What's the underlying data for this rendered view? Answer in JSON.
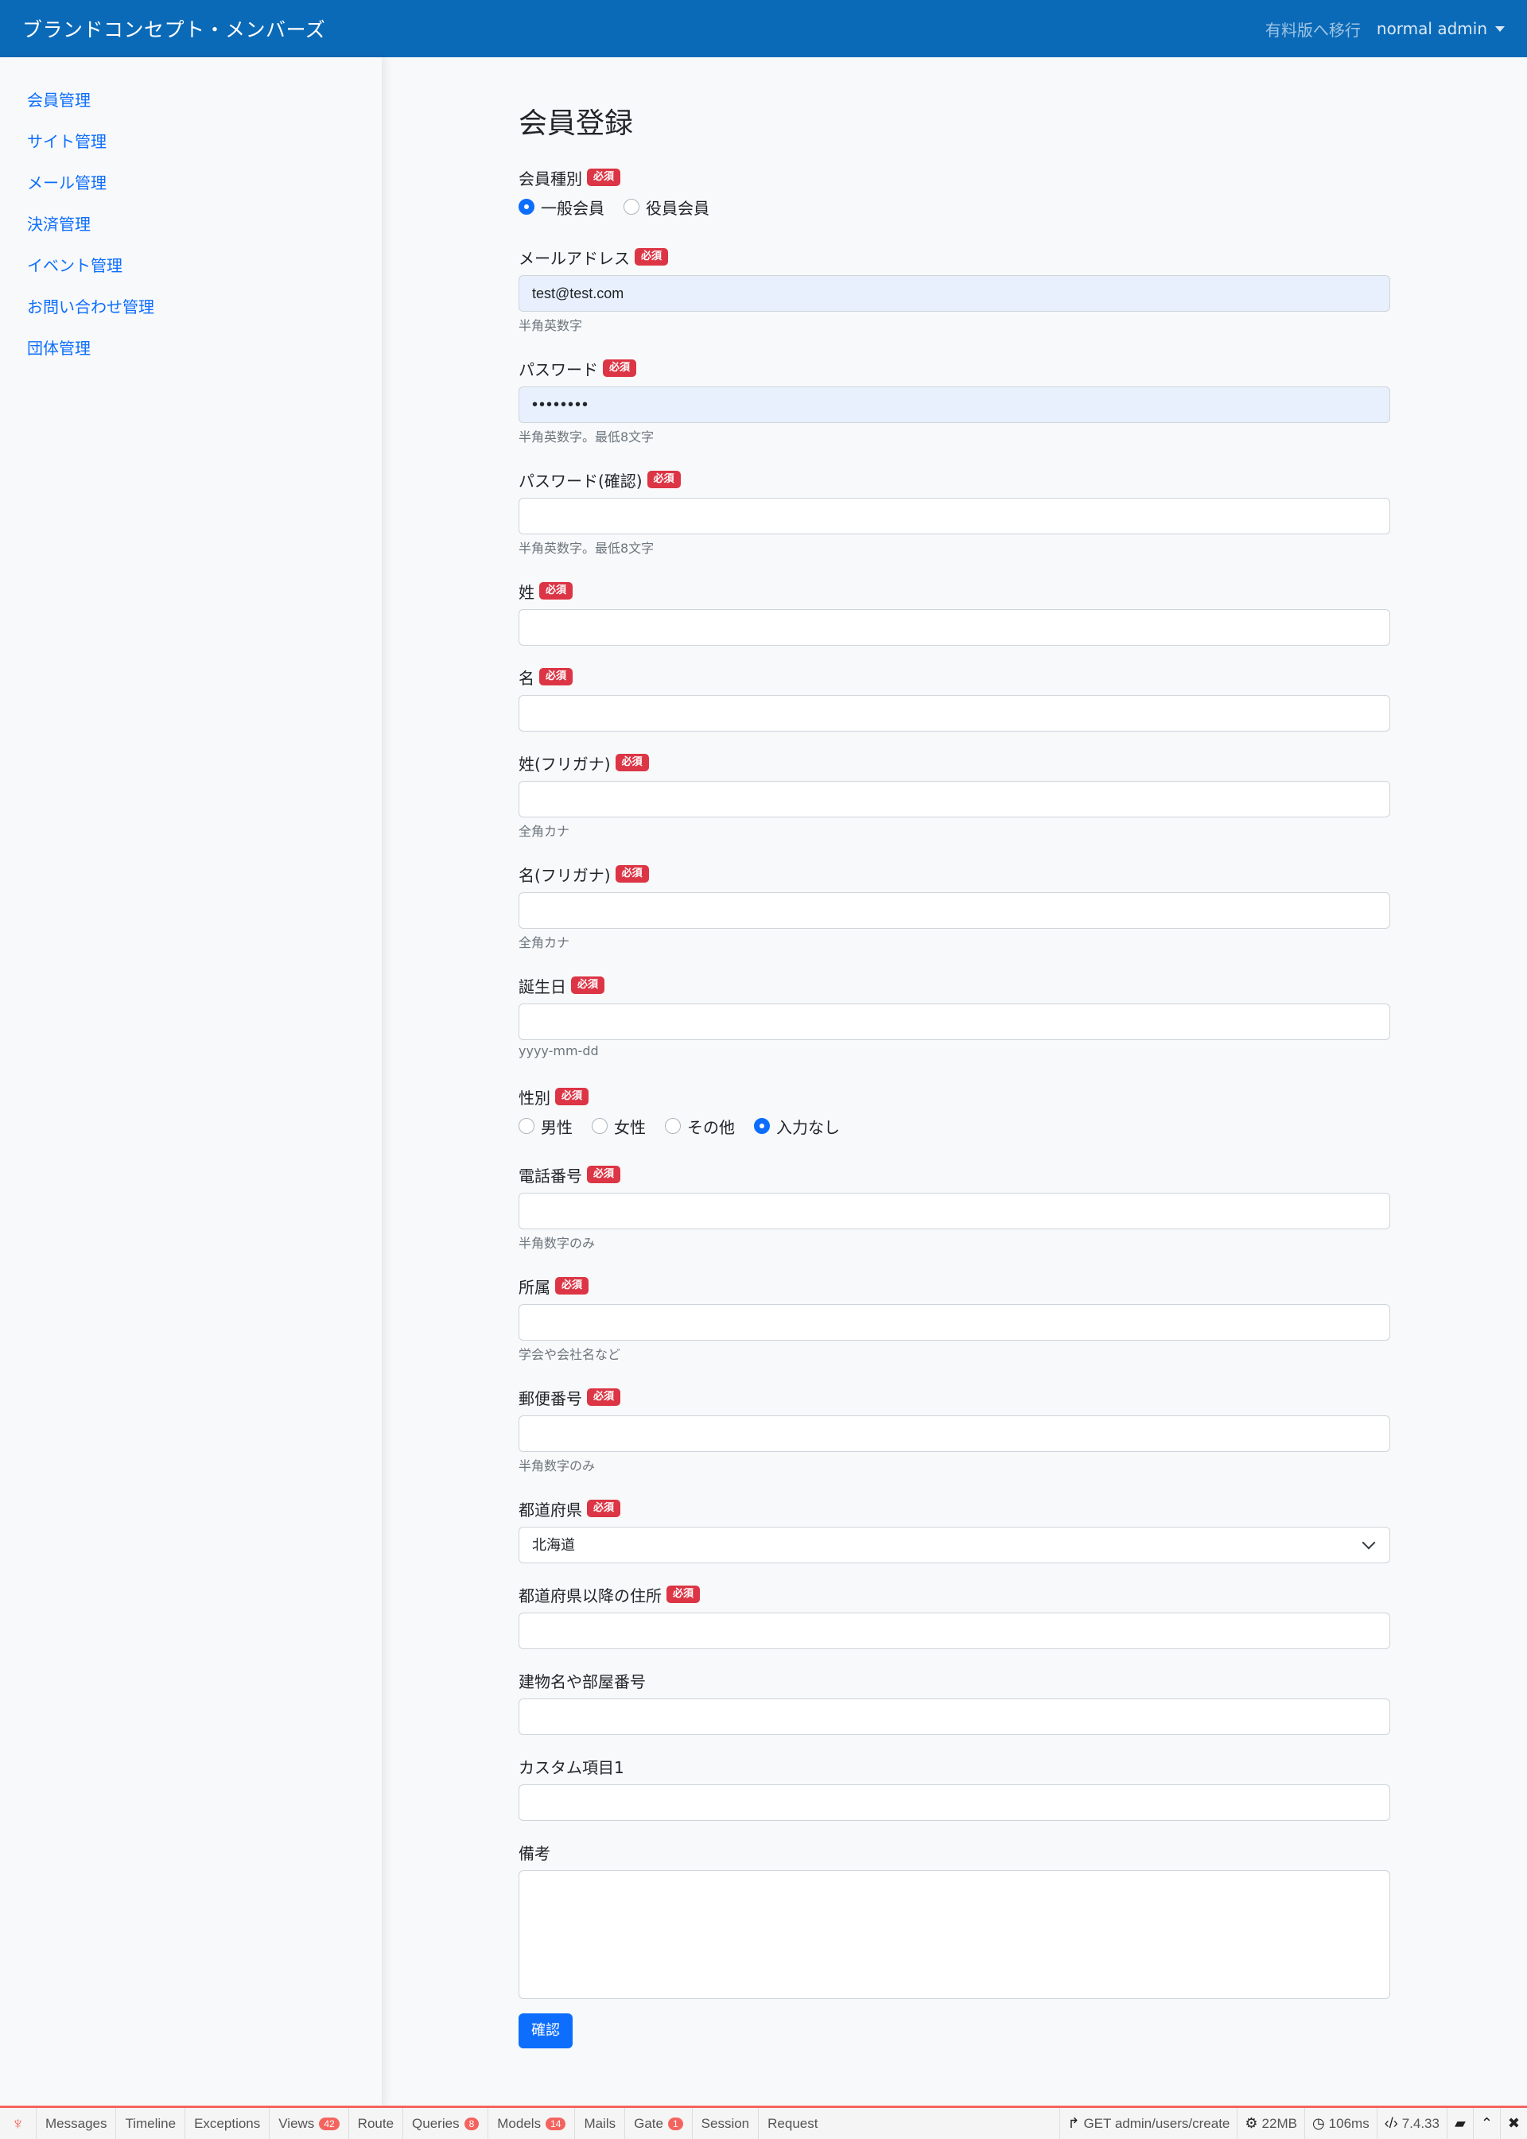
{
  "navbar": {
    "brand": "ブランドコンセプト・メンバーズ",
    "upgrade": "有料版へ移行",
    "user": "normal admin"
  },
  "sidebar": {
    "items": [
      {
        "label": "会員管理"
      },
      {
        "label": "サイト管理"
      },
      {
        "label": "メール管理"
      },
      {
        "label": "決済管理"
      },
      {
        "label": "イベント管理"
      },
      {
        "label": "お問い合わせ管理"
      },
      {
        "label": "団体管理"
      }
    ]
  },
  "form": {
    "title": "会員登録",
    "required_badge": "必須",
    "member_type": {
      "label": "会員種別",
      "options": [
        "一般会員",
        "役員会員"
      ],
      "selected": "一般会員"
    },
    "email": {
      "label": "メールアドレス",
      "value": "test@test.com",
      "help": "半角英数字"
    },
    "password": {
      "label": "パスワード",
      "value": "••••••••",
      "help": "半角英数字。最低8文字"
    },
    "password_confirm": {
      "label": "パスワード(確認)",
      "value": "",
      "help": "半角英数字。最低8文字"
    },
    "last_name": {
      "label": "姓",
      "value": ""
    },
    "first_name": {
      "label": "名",
      "value": ""
    },
    "last_name_kana": {
      "label": "姓(フリガナ)",
      "value": "",
      "help": "全角カナ"
    },
    "first_name_kana": {
      "label": "名(フリガナ)",
      "value": "",
      "help": "全角カナ"
    },
    "birthday": {
      "label": "誕生日",
      "value": "",
      "help": "yyyy-mm-dd"
    },
    "gender": {
      "label": "性別",
      "options": [
        "男性",
        "女性",
        "その他",
        "入力なし"
      ],
      "selected": "入力なし"
    },
    "phone": {
      "label": "電話番号",
      "value": "",
      "help": "半角数字のみ"
    },
    "affiliation": {
      "label": "所属",
      "value": "",
      "help": "学会や会社名など"
    },
    "postal_code": {
      "label": "郵便番号",
      "value": "",
      "help": "半角数字のみ"
    },
    "prefecture": {
      "label": "都道府県",
      "value": "北海道"
    },
    "address": {
      "label": "都道府県以降の住所",
      "value": ""
    },
    "building": {
      "label": "建物名や部屋番号",
      "value": ""
    },
    "custom1": {
      "label": "カスタム項目1",
      "value": ""
    },
    "notes": {
      "label": "備考",
      "value": ""
    },
    "submit": "確認"
  },
  "debugbar": {
    "tabs": [
      {
        "label": "Messages",
        "badge": ""
      },
      {
        "label": "Timeline",
        "badge": ""
      },
      {
        "label": "Exceptions",
        "badge": ""
      },
      {
        "label": "Views",
        "badge": "42"
      },
      {
        "label": "Route",
        "badge": ""
      },
      {
        "label": "Queries",
        "badge": "8"
      },
      {
        "label": "Models",
        "badge": "14"
      },
      {
        "label": "Mails",
        "badge": ""
      },
      {
        "label": "Gate",
        "badge": "1"
      },
      {
        "label": "Session",
        "badge": ""
      },
      {
        "label": "Request",
        "badge": ""
      }
    ],
    "route": "GET admin/users/create",
    "memory": "22MB",
    "time": "106ms",
    "php": "7.4.33"
  },
  "colors": {
    "primary": "#0d6efd",
    "navbar": "#0b6ab8",
    "danger": "#dc3545",
    "autofill": "#e8f0fe"
  }
}
